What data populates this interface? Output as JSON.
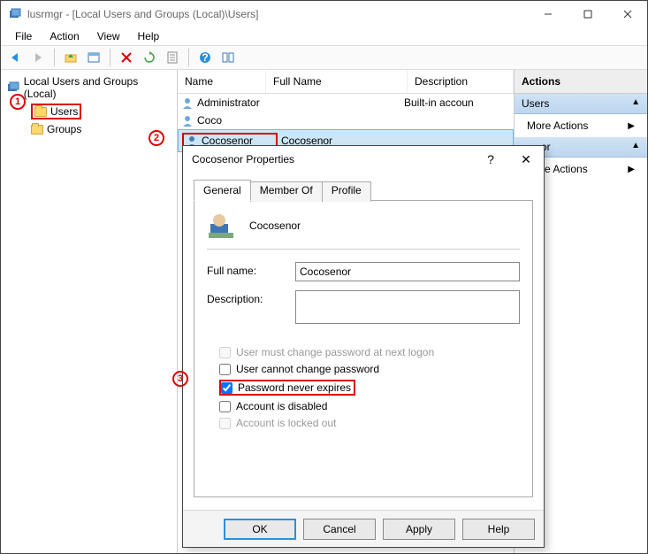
{
  "window": {
    "title": "lusrmgr - [Local Users and Groups (Local)\\Users]"
  },
  "menu": {
    "file": "File",
    "action": "Action",
    "view": "View",
    "help": "Help"
  },
  "tree": {
    "root": "Local Users and Groups (Local)",
    "users": "Users",
    "groups": "Groups"
  },
  "list": {
    "headers": {
      "name": "Name",
      "fullname": "Full Name",
      "description": "Description"
    },
    "rows": [
      {
        "name": "Administrator",
        "fullname": "",
        "description": "Built-in accoun"
      },
      {
        "name": "Coco",
        "fullname": "",
        "description": ""
      },
      {
        "name": "Cocosenor",
        "fullname": "Cocosenor",
        "description": ""
      }
    ]
  },
  "actions": {
    "title": "Actions",
    "section1": "Users",
    "more1": "More Actions",
    "section2_suffix": "or",
    "more2_suffix": "re Actions"
  },
  "dialog": {
    "title": "Cocosenor Properties",
    "tabs": {
      "general": "General",
      "memberof": "Member Of",
      "profile": "Profile"
    },
    "username": "Cocosenor",
    "labels": {
      "fullname": "Full name:",
      "description": "Description:"
    },
    "fields": {
      "fullname": "Cocosenor",
      "description": ""
    },
    "checks": {
      "must_change": "User must change password at next logon",
      "cannot_change": "User cannot change password",
      "never_expires": "Password never expires",
      "disabled": "Account is disabled",
      "locked": "Account is locked out"
    },
    "buttons": {
      "ok": "OK",
      "cancel": "Cancel",
      "apply": "Apply",
      "help": "Help"
    }
  },
  "annotations": {
    "one": "1",
    "two": "2",
    "three": "3"
  }
}
